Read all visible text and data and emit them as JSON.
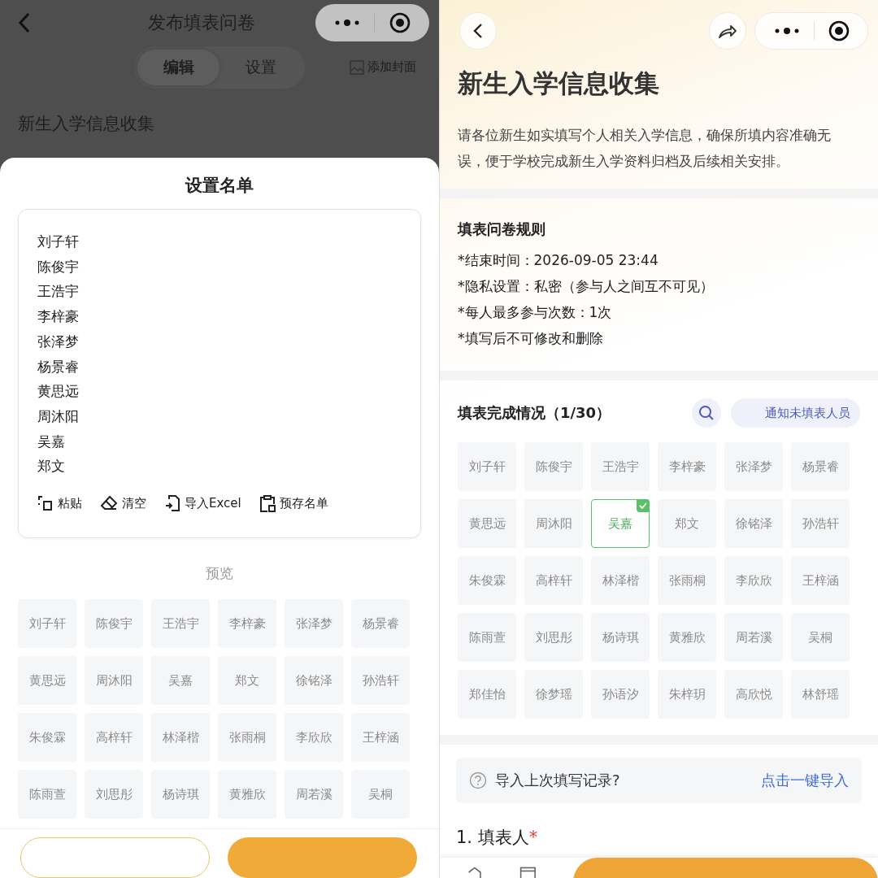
{
  "left": {
    "header": {
      "title": "发布填表问卷"
    },
    "tabs": [
      {
        "label": "编辑",
        "selected": true
      },
      {
        "label": "设置",
        "selected": false
      }
    ],
    "cover_link": "添加封面",
    "form_title": "新生入学信息收集",
    "sheet": {
      "title": "设置名单",
      "names": [
        "刘子轩",
        "陈俊宇",
        "王浩宇",
        "李梓豪",
        "张泽梦",
        "杨景睿",
        "黄思远",
        "周沐阳",
        "吴嘉",
        "郑文"
      ],
      "tools": [
        {
          "kind": "paste",
          "label": "粘贴"
        },
        {
          "kind": "clear",
          "label": "清空"
        },
        {
          "kind": "import",
          "label": "导入Excel"
        },
        {
          "kind": "save",
          "label": "预存名单"
        }
      ],
      "preview_label": "预览",
      "preview": [
        "刘子轩",
        "陈俊宇",
        "王浩宇",
        "李梓豪",
        "张泽梦",
        "杨景睿",
        "黄思远",
        "周沐阳",
        "吴嘉",
        "郑文",
        "徐铭泽",
        "孙浩轩",
        "朱俊霖",
        "高梓轩",
        "林泽楷",
        "张雨桐",
        "李欣欣",
        "王梓涵",
        "陈雨萱",
        "刘思彤",
        "杨诗琪",
        "黄雅欣",
        "周若溪",
        "吴桐"
      ]
    }
  },
  "right": {
    "title": "新生入学信息收集",
    "description": "请各位新生如实填写个人相关入学信息，确保所填内容准确无误，便于学校完成新生入学资料归档及后续相关安排。",
    "rules": {
      "title": "填表问卷规则",
      "items": [
        "*结束时间：2026-09-05 23:44",
        "*隐私设置：私密（参与人之间互不可见）",
        "*每人最多参与次数：1次",
        "*填写后不可修改和删除"
      ]
    },
    "completion": {
      "title": "填表完成情况（1/30）",
      "notify": "通知未填表人员",
      "members": [
        {
          "name": "刘子轩",
          "done": false
        },
        {
          "name": "陈俊宇",
          "done": false
        },
        {
          "name": "王浩宇",
          "done": false
        },
        {
          "name": "李梓豪",
          "done": false
        },
        {
          "name": "张泽梦",
          "done": false
        },
        {
          "name": "杨景睿",
          "done": false
        },
        {
          "name": "黄思远",
          "done": false
        },
        {
          "name": "周沐阳",
          "done": false
        },
        {
          "name": "吴嘉",
          "done": true
        },
        {
          "name": "郑文",
          "done": false
        },
        {
          "name": "徐铭泽",
          "done": false
        },
        {
          "name": "孙浩轩",
          "done": false
        },
        {
          "name": "朱俊霖",
          "done": false
        },
        {
          "name": "高梓轩",
          "done": false
        },
        {
          "name": "林泽楷",
          "done": false
        },
        {
          "name": "张雨桐",
          "done": false
        },
        {
          "name": "李欣欣",
          "done": false
        },
        {
          "name": "王梓涵",
          "done": false
        },
        {
          "name": "陈雨萱",
          "done": false
        },
        {
          "name": "刘思彤",
          "done": false
        },
        {
          "name": "杨诗琪",
          "done": false
        },
        {
          "name": "黄雅欣",
          "done": false
        },
        {
          "name": "周若溪",
          "done": false
        },
        {
          "name": "吴桐",
          "done": false
        },
        {
          "name": "郑佳怡",
          "done": false
        },
        {
          "name": "徐梦瑶",
          "done": false
        },
        {
          "name": "孙语汐",
          "done": false
        },
        {
          "name": "朱梓玥",
          "done": false
        },
        {
          "name": "高欣悦",
          "done": false
        },
        {
          "name": "林舒瑶",
          "done": false
        }
      ]
    },
    "import": {
      "question": "导入上次填写记录?",
      "action": "点击一键导入"
    },
    "question": {
      "title": "1. 填表人",
      "required_mark": "*"
    }
  }
}
